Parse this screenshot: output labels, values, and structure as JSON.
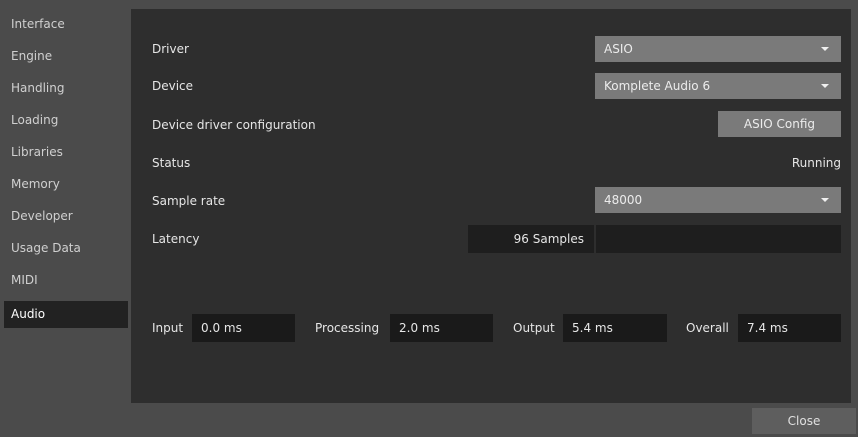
{
  "sidebar": {
    "items": [
      {
        "label": "Interface"
      },
      {
        "label": "Engine"
      },
      {
        "label": "Handling"
      },
      {
        "label": "Loading"
      },
      {
        "label": "Libraries"
      },
      {
        "label": "Memory"
      },
      {
        "label": "Developer"
      },
      {
        "label": "Usage Data"
      },
      {
        "label": "MIDI"
      },
      {
        "label": "Audio"
      }
    ],
    "active": "Audio"
  },
  "audio": {
    "driver": {
      "label": "Driver",
      "value": "ASIO"
    },
    "device": {
      "label": "Device",
      "value": "Komplete Audio 6"
    },
    "device_config": {
      "label": "Device driver configuration",
      "button": "ASIO Config"
    },
    "status": {
      "label": "Status",
      "value": "Running"
    },
    "sample_rate": {
      "label": "Sample rate",
      "value": "48000"
    },
    "latency": {
      "label": "Latency",
      "value": "96 Samples"
    },
    "stats": {
      "input": {
        "label": "Input",
        "value": "0.0 ms"
      },
      "processing": {
        "label": "Processing",
        "value": "2.0 ms"
      },
      "output": {
        "label": "Output",
        "value": "5.4 ms"
      },
      "overall": {
        "label": "Overall",
        "value": "7.4 ms"
      }
    }
  },
  "footer": {
    "close_label": "Close"
  },
  "colors": {
    "background": "#4b4b4b",
    "panel": "#2e2e2e",
    "control": "#7a7a7a",
    "field": "#1e1e1e",
    "active_item": "#222222"
  }
}
